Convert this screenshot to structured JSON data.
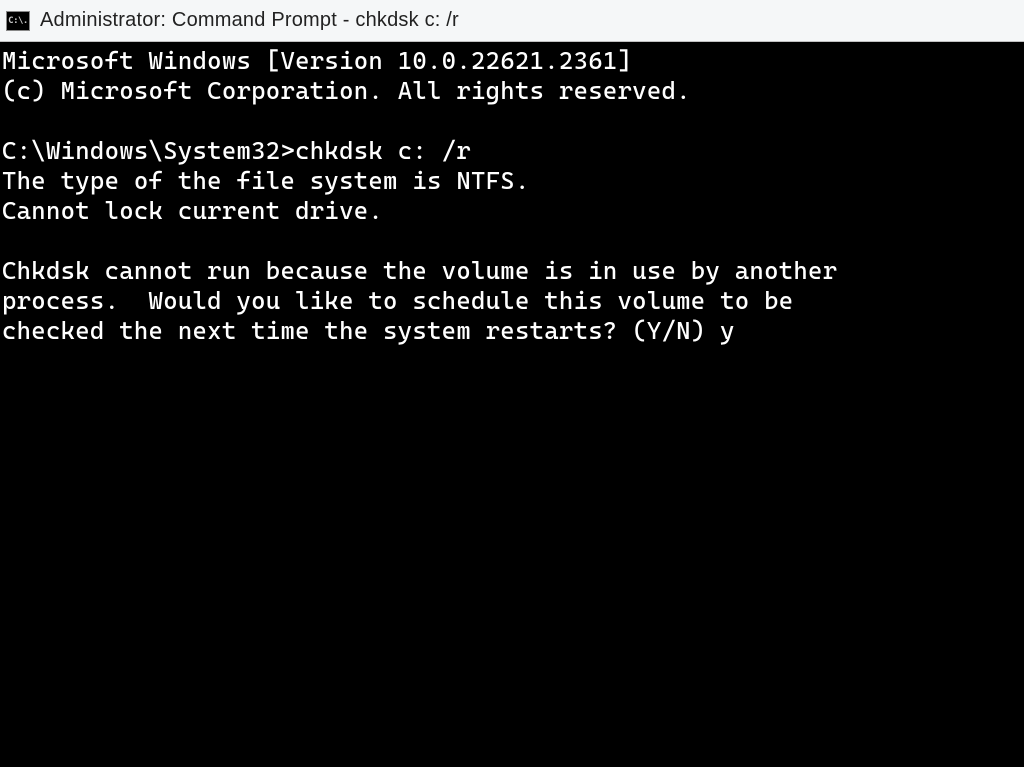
{
  "window": {
    "icon_text": "C:\\.",
    "title": "Administrator: Command Prompt - chkdsk  c: /r"
  },
  "terminal": {
    "banner_line1": "Microsoft Windows [Version 10.0.22621.2361]",
    "banner_line2": "(c) Microsoft Corporation. All rights reserved.",
    "prompt_path": "C:\\Windows\\System32",
    "prompt_separator": ">",
    "command": "chkdsk c: /r",
    "output_line1": "The type of the file system is NTFS.",
    "output_line2": "Cannot lock current drive.",
    "output_paragraph": "Chkdsk cannot run because the volume is in use by another\nprocess.  Would you like to schedule this volume to be\nchecked the next time the system restarts? (Y/N) ",
    "user_response": "y"
  }
}
